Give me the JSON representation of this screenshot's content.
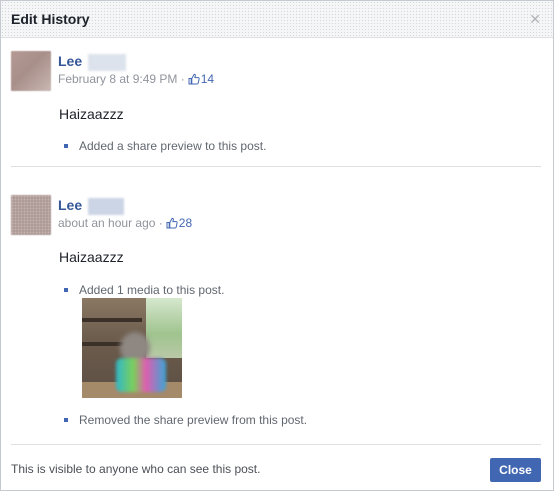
{
  "dialog": {
    "title": "Edit History",
    "close_icon": "close-icon"
  },
  "entries": [
    {
      "name": "Lee",
      "timestamp": "February 8 at 9:49 PM",
      "separator": "·",
      "like_icon": "thumbs-up-icon",
      "likes": "14",
      "text": "Haizaazzz",
      "changes": [
        "Added a share preview to this post."
      ]
    },
    {
      "name": "Lee",
      "timestamp": "about an hour ago",
      "separator": "·",
      "like_icon": "thumbs-up-icon",
      "likes": "28",
      "text": "Haizaazzz",
      "changes": [
        "Added 1 media to this post.",
        "Removed the share preview from this post."
      ]
    }
  ],
  "footer": {
    "visibility_text": "This is visible to anyone who can see this post.",
    "close_label": "Close"
  },
  "colors": {
    "link_blue": "#365899",
    "button_blue": "#4267b2",
    "meta_gray": "#90949c"
  }
}
